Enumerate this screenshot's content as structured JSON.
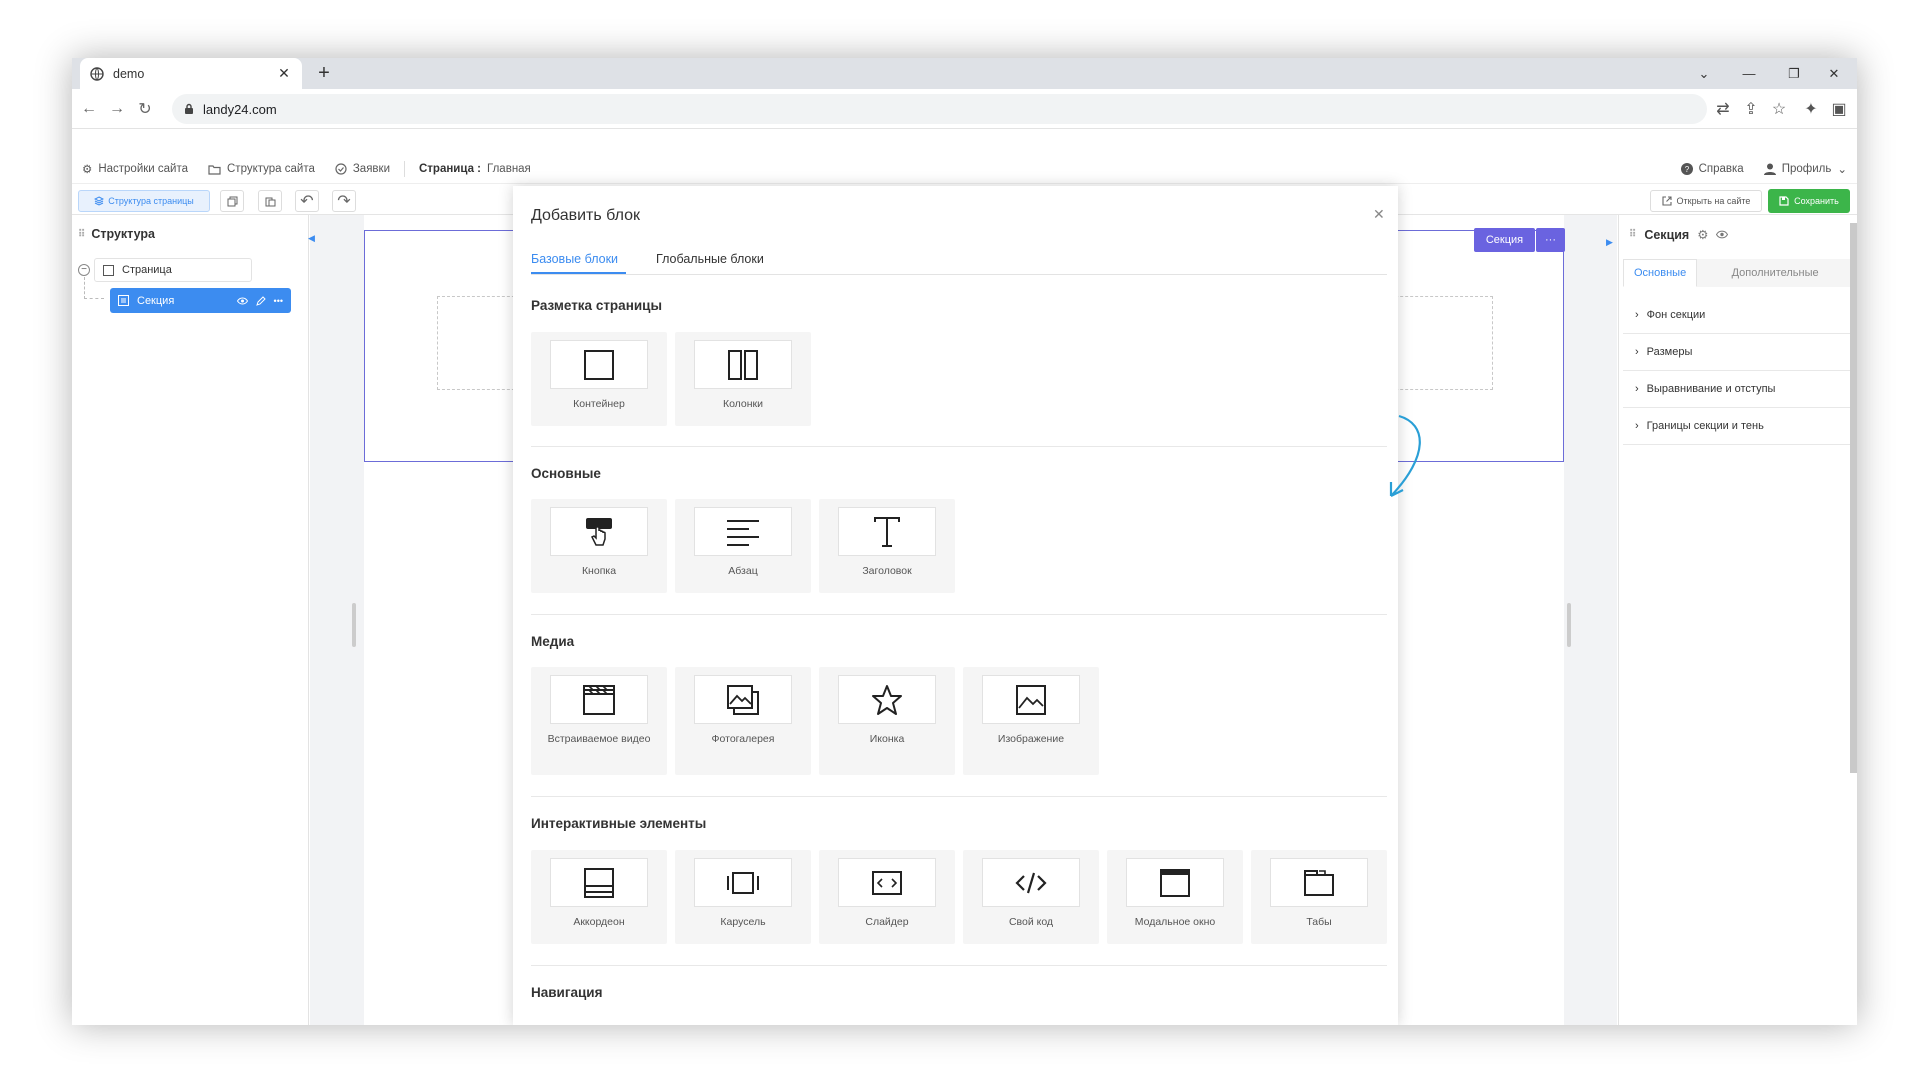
{
  "browser": {
    "tab_title": "demo",
    "url": "landy24.com"
  },
  "appbar": {
    "site_settings": "Настройки сайта",
    "site_structure": "Структура сайта",
    "requests": "Заявки",
    "page_label": "Страница :",
    "page_value": "Главная",
    "help": "Справка",
    "profile": "Профиль"
  },
  "toolbar": {
    "page_structure": "Структура страницы",
    "open_on_site": "Открыть на сайте",
    "save": "Сохранить"
  },
  "left_panel": {
    "title": "Структура",
    "tree_page": "Страница",
    "tree_section": "Секция"
  },
  "canvas": {
    "section_badge": "Секция",
    "section_more": "···"
  },
  "right_panel": {
    "title": "Секция",
    "tabs": [
      "Основные",
      "Дополнительные"
    ],
    "items": [
      "Фон секции",
      "Размеры",
      "Выравнивание и отступы",
      "Границы секции и тень"
    ]
  },
  "modal": {
    "title": "Добавить блок",
    "tabs": [
      "Базовые блоки",
      "Глобальные блоки"
    ],
    "sections": [
      {
        "title": "Разметка страницы",
        "items": [
          {
            "label": "Контейнер",
            "icon": "container-icon"
          },
          {
            "label": "Колонки",
            "icon": "columns-icon"
          }
        ]
      },
      {
        "title": "Основные",
        "items": [
          {
            "label": "Кнопка",
            "icon": "button-icon"
          },
          {
            "label": "Абзац",
            "icon": "paragraph-icon"
          },
          {
            "label": "Заголовок",
            "icon": "heading-icon"
          }
        ]
      },
      {
        "title": "Медиа",
        "items": [
          {
            "label": "Встраиваемое видео",
            "icon": "video-icon"
          },
          {
            "label": "Фотогалерея",
            "icon": "gallery-icon"
          },
          {
            "label": "Иконка",
            "icon": "star-icon"
          },
          {
            "label": "Изображение",
            "icon": "image-icon"
          }
        ]
      },
      {
        "title": "Интерактивные элементы",
        "items": [
          {
            "label": "Аккордеон",
            "icon": "accordion-icon"
          },
          {
            "label": "Карусель",
            "icon": "carousel-icon"
          },
          {
            "label": "Слайдер",
            "icon": "slider-icon"
          },
          {
            "label": "Свой код",
            "icon": "code-icon"
          },
          {
            "label": "Модальное окно",
            "icon": "modal-window-icon"
          },
          {
            "label": "Табы",
            "icon": "tabs-icon"
          }
        ]
      },
      {
        "title": "Навигация",
        "items": []
      }
    ]
  },
  "colors": {
    "accent": "#3c8cf0",
    "section": "#6a63e0",
    "save": "#3cb54a"
  }
}
